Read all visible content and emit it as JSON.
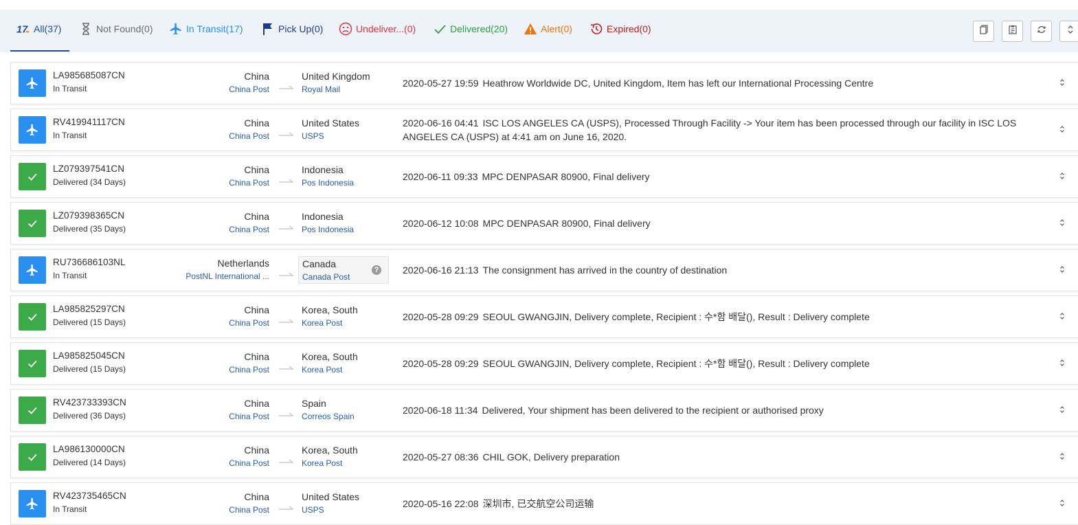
{
  "tabs": [
    {
      "label": "All(37)",
      "icon": "17track-logo-icon",
      "color": "#1e4e9b"
    },
    {
      "label": "Not Found(0)",
      "icon": "hourglass-icon",
      "color": "#6b6b6b"
    },
    {
      "label": "In Transit(17)",
      "icon": "airplane-icon",
      "color": "#2b8ff0"
    },
    {
      "label": "Pick Up(0)",
      "icon": "flag-icon",
      "color": "#1e3a8a"
    },
    {
      "label": "Undeliver...(0)",
      "icon": "sad-face-icon",
      "color": "#d9363e"
    },
    {
      "label": "Delivered(20)",
      "icon": "checkmark-icon",
      "color": "#2e9e43"
    },
    {
      "label": "Alert(0)",
      "icon": "warning-icon",
      "color": "#f0730e"
    },
    {
      "label": "Expired(0)",
      "icon": "history-clock-icon",
      "color": "#b81f1f"
    }
  ],
  "toolbar": {
    "buttons": [
      "copy-icon",
      "paste-icon",
      "refresh-icon",
      "expand-collapse-icon"
    ]
  },
  "colors": {
    "transit": "#2b8ff0",
    "delivered": "#3daa4a",
    "carrier_link": "#2b5ba8",
    "tabs_background": "#eef2f9"
  },
  "shipments": [
    {
      "number": "LA985685087CN",
      "status": "In Transit",
      "status_type": "transit",
      "origin_country": "China",
      "origin_carrier": "China Post",
      "dest_country": "United Kingdom",
      "dest_carrier": "Royal Mail",
      "event_time": "2020-05-27 19:59",
      "event_text": "Heathrow Worldwide DC, United Kingdom, Item has left our International Processing Centre"
    },
    {
      "number": "RV419941117CN",
      "status": "In Transit",
      "status_type": "transit",
      "origin_country": "China",
      "origin_carrier": "China Post",
      "dest_country": "United States",
      "dest_carrier": "USPS",
      "event_time": "2020-06-16 04:41",
      "event_text": "ISC LOS ANGELES CA (USPS), Processed Through Facility -> Your item has been processed through our facility in ISC LOS ANGELES CA (USPS) at 4:41 am on June 16, 2020."
    },
    {
      "number": "LZ079397541CN",
      "status": "Delivered (34 Days)",
      "status_type": "delivered",
      "origin_country": "China",
      "origin_carrier": "China Post",
      "dest_country": "Indonesia",
      "dest_carrier": "Pos Indonesia",
      "event_time": "2020-06-11 09:33",
      "event_text": "MPC DENPASAR 80900, Final delivery"
    },
    {
      "number": "LZ079398365CN",
      "status": "Delivered (35 Days)",
      "status_type": "delivered",
      "origin_country": "China",
      "origin_carrier": "China Post",
      "dest_country": "Indonesia",
      "dest_carrier": "Pos Indonesia",
      "event_time": "2020-06-12 10:08",
      "event_text": "MPC DENPASAR 80900, Final delivery"
    },
    {
      "number": "RU736686103NL",
      "status": "In Transit",
      "status_type": "transit",
      "origin_country": "Netherlands",
      "origin_carrier": "PostNL International ...",
      "dest_country": "Canada",
      "dest_carrier": "Canada Post",
      "dest_boxed": true,
      "event_time": "2020-06-16 21:13",
      "event_text": "The consignment has arrived in the country of destination"
    },
    {
      "number": "LA985825297CN",
      "status": "Delivered (15 Days)",
      "status_type": "delivered",
      "origin_country": "China",
      "origin_carrier": "China Post",
      "dest_country": "Korea, South",
      "dest_carrier": "Korea Post",
      "event_time": "2020-05-28 09:29",
      "event_text": "SEOUL GWANGJIN, Delivery complete, Recipient : 수*함 배달(), Result : Delivery complete"
    },
    {
      "number": "LA985825045CN",
      "status": "Delivered (15 Days)",
      "status_type": "delivered",
      "origin_country": "China",
      "origin_carrier": "China Post",
      "dest_country": "Korea, South",
      "dest_carrier": "Korea Post",
      "event_time": "2020-05-28 09:29",
      "event_text": "SEOUL GWANGJIN, Delivery complete, Recipient : 수*함 배달(), Result : Delivery complete"
    },
    {
      "number": "RV423733393CN",
      "status": "Delivered (36 Days)",
      "status_type": "delivered",
      "origin_country": "China",
      "origin_carrier": "China Post",
      "dest_country": "Spain",
      "dest_carrier": "Correos Spain",
      "event_time": "2020-06-18 11:34",
      "event_text": "Delivered, Your shipment has been delivered to the recipient or authorised proxy"
    },
    {
      "number": "LA986130000CN",
      "status": "Delivered (14 Days)",
      "status_type": "delivered",
      "origin_country": "China",
      "origin_carrier": "China Post",
      "dest_country": "Korea, South",
      "dest_carrier": "Korea Post",
      "event_time": "2020-05-27 08:36",
      "event_text": "CHIL GOK, Delivery preparation"
    },
    {
      "number": "RV423735465CN",
      "status": "In Transit",
      "status_type": "transit",
      "origin_country": "China",
      "origin_carrier": "China Post",
      "dest_country": "United States",
      "dest_carrier": "USPS",
      "event_time": "2020-05-16 22:08",
      "event_text": "深圳市, 已交航空公司运输"
    }
  ]
}
